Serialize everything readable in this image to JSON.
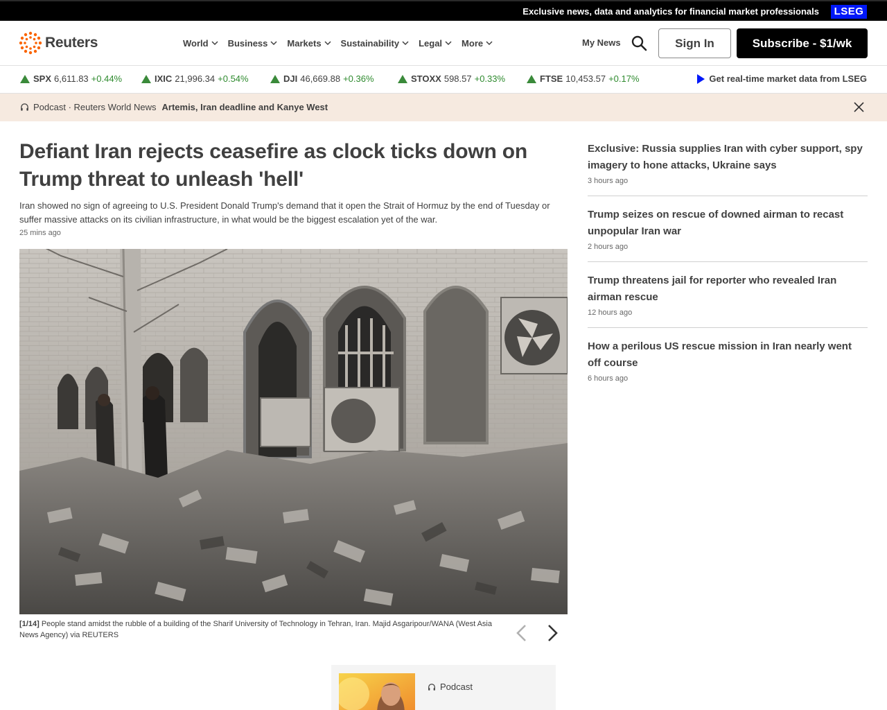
{
  "topbar": {
    "text": "Exclusive news, data and analytics for financial market professionals",
    "badge": "LSEG"
  },
  "header": {
    "logo_text": "Reuters",
    "nav": [
      "World",
      "Business",
      "Markets",
      "Sustainability",
      "Legal",
      "More"
    ],
    "my_news": "My News",
    "sign_in": "Sign In",
    "subscribe": "Subscribe - $1/wk"
  },
  "ticker": {
    "items": [
      {
        "symbol": "SPX",
        "value": "6,611.83",
        "change": "+0.44%"
      },
      {
        "symbol": "IXIC",
        "value": "21,996.34",
        "change": "+0.54%"
      },
      {
        "symbol": "DJI",
        "value": "46,669.88",
        "change": "+0.36%"
      },
      {
        "symbol": "STOXX",
        "value": "598.57",
        "change": "+0.33%"
      },
      {
        "symbol": "FTSE",
        "value": "10,453.57",
        "change": "+0.17%"
      }
    ],
    "lseg_link": "Get real-time market data from LSEG"
  },
  "podcast_strip": {
    "label": "Podcast · Reuters World News",
    "title": "Artemis, Iran deadline and Kanye West"
  },
  "article": {
    "headline": "Defiant Iran rejects ceasefire as clock ticks down on Trump threat to unleash 'hell'",
    "summary": "Iran showed no sign of agreeing to U.S. President Donald Trump's demand that it open the Strait of Hormuz by the end of Tuesday or suffer massive attacks on its civilian infrastructure, in what would be the biggest escalation yet of the war.",
    "time_ago": "25 mins ago",
    "caption_count": "[1/14]",
    "caption": "People stand amidst the rubble of a building of the Sharif University of Technology in Tehran, Iran. Majid Asgaripour/WANA (West Asia News Agency) via REUTERS"
  },
  "podcast_card": {
    "label": "Podcast"
  },
  "sidebar": {
    "items": [
      {
        "title": "Exclusive: Russia supplies Iran with cyber support, spy imagery to hone attacks, Ukraine says",
        "time": "3 hours ago"
      },
      {
        "title": "Trump seizes on rescue of downed airman to recast unpopular Iran war",
        "time": "2 hours ago"
      },
      {
        "title": "Trump threatens jail for reporter who revealed Iran airman rescue",
        "time": "12 hours ago"
      },
      {
        "title": "How a perilous US rescue mission in Iran nearly went off course",
        "time": "6 hours ago"
      }
    ]
  },
  "colors": {
    "lseg_blue": "#0018f9",
    "ticker_up": "#2e8a2e",
    "podcast_strip_bg": "#f6eae0",
    "logo_orange": "#fa6400"
  }
}
